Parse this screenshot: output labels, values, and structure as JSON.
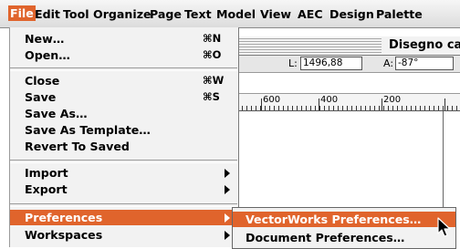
{
  "menubar": {
    "items": [
      {
        "label": "File",
        "active": true
      },
      {
        "label": "Edit"
      },
      {
        "label": "Tool"
      },
      {
        "label": "Organize"
      },
      {
        "label": "Page"
      },
      {
        "label": "Text"
      },
      {
        "label": "Model"
      },
      {
        "label": "View"
      },
      {
        "label": "AEC"
      },
      {
        "label": "Design"
      },
      {
        "label": "Palette"
      }
    ]
  },
  "document": {
    "title": "Disegno ca",
    "length_label": "L:",
    "length_value": "1496,88",
    "angle_label": "A:",
    "angle_value": "-87°",
    "ruler": [
      "600",
      "400",
      "200"
    ]
  },
  "file_menu": {
    "items": [
      {
        "label": "New…",
        "shortcut": "⌘N"
      },
      {
        "label": "Open…",
        "shortcut": "⌘O"
      },
      {
        "label": "Close",
        "shortcut": "⌘W"
      },
      {
        "label": "Save",
        "shortcut": "⌘S"
      },
      {
        "label": "Save As…",
        "shortcut": ""
      },
      {
        "label": "Save As Template…",
        "shortcut": ""
      },
      {
        "label": "Revert To Saved",
        "shortcut": ""
      },
      {
        "label": "Import",
        "submenu": true
      },
      {
        "label": "Export",
        "submenu": true
      },
      {
        "label": "Preferences",
        "submenu": true,
        "highlighted": true
      },
      {
        "label": "Workspaces",
        "submenu": true
      }
    ]
  },
  "preferences_submenu": {
    "items": [
      {
        "label": "VectorWorks Preferences…",
        "highlighted": true
      },
      {
        "label": "Document Preferences…"
      }
    ]
  },
  "colors": {
    "highlight": "#e0642c",
    "menu_bg": "#f2f2f2"
  },
  "icons": {
    "cursor": "arrow-cursor-icon"
  }
}
